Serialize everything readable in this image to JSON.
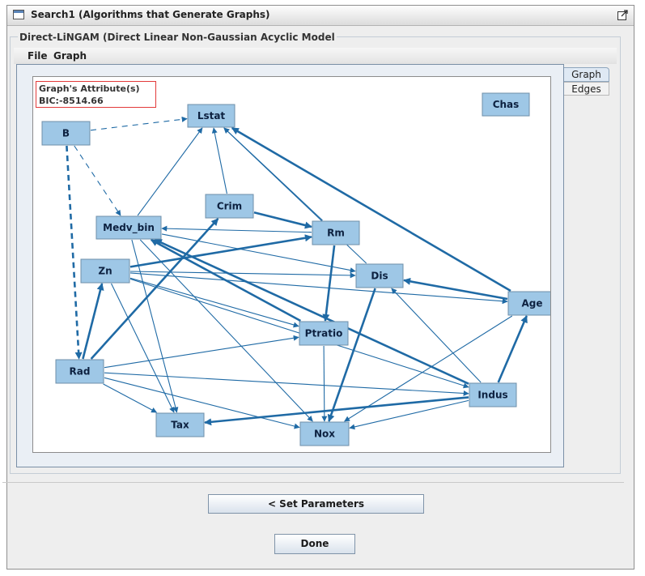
{
  "window": {
    "title": "Search1 (Algorithms that Generate Graphs)",
    "icon": "window-icon",
    "maximize_icon": "maximize-icon"
  },
  "panel": {
    "group_title": "Direct-LiNGAM (Direct Linear Non-Gaussian Acyclic Model",
    "menu": [
      "File",
      "Graph"
    ]
  },
  "graph_attributes": {
    "title": "Graph's Attribute(s)",
    "bic": "BIC:-8514.66"
  },
  "tabs": [
    {
      "label": "Graph",
      "selected": true
    },
    {
      "label": "Edges",
      "selected": false
    }
  ],
  "graph": {
    "nodes": [
      "Lstat",
      "B",
      "Chas",
      "Crim",
      "Medv_bin",
      "Rm",
      "Zn",
      "Dis",
      "Age",
      "Ptratio",
      "Rad",
      "Indus",
      "Tax",
      "Nox"
    ],
    "edges": [
      {
        "from": "B",
        "to": "Lstat",
        "style": "dashed"
      },
      {
        "from": "B",
        "to": "Medv_bin",
        "style": "dashed"
      },
      {
        "from": "B",
        "to": "Rad",
        "style": "dashed-bold"
      },
      {
        "from": "Medv_bin",
        "to": "Lstat",
        "style": "thin"
      },
      {
        "from": "Crim",
        "to": "Lstat",
        "style": "thin"
      },
      {
        "from": "Rm",
        "to": "Lstat",
        "style": "thin"
      },
      {
        "from": "Dis",
        "to": "Lstat",
        "style": "thin"
      },
      {
        "from": "Age",
        "to": "Lstat",
        "style": "bold"
      },
      {
        "from": "Crim",
        "to": "Rm",
        "style": "bold"
      },
      {
        "from": "Rm",
        "to": "Medv_bin",
        "style": "thin"
      },
      {
        "from": "Zn",
        "to": "Rm",
        "style": "bold"
      },
      {
        "from": "Rm",
        "to": "Ptratio",
        "style": "bold"
      },
      {
        "from": "Medv_bin",
        "to": "Dis",
        "style": "thin"
      },
      {
        "from": "Zn",
        "to": "Dis",
        "style": "thin"
      },
      {
        "from": "Zn",
        "to": "Age",
        "style": "thin"
      },
      {
        "from": "Zn",
        "to": "Ptratio",
        "style": "thin"
      },
      {
        "from": "Zn",
        "to": "Tax",
        "style": "thin"
      },
      {
        "from": "Rad",
        "to": "Zn",
        "style": "bold"
      },
      {
        "from": "Rad",
        "to": "Crim",
        "style": "bold"
      },
      {
        "from": "Medv_bin",
        "to": "Tax",
        "style": "thin"
      },
      {
        "from": "Medv_bin",
        "to": "Nox",
        "style": "thin"
      },
      {
        "from": "Indus",
        "to": "Medv_bin",
        "style": "bold"
      },
      {
        "from": "Ptratio",
        "to": "Medv_bin",
        "style": "bold"
      },
      {
        "from": "Age",
        "to": "Dis",
        "style": "bold"
      },
      {
        "from": "Dis",
        "to": "Nox",
        "style": "bold"
      },
      {
        "from": "Ptratio",
        "to": "Nox",
        "style": "thin"
      },
      {
        "from": "Age",
        "to": "Nox",
        "style": "thin"
      },
      {
        "from": "Indus",
        "to": "Nox",
        "style": "thin"
      },
      {
        "from": "Indus",
        "to": "Tax",
        "style": "bold"
      },
      {
        "from": "Indus",
        "to": "Age",
        "style": "bold"
      },
      {
        "from": "Indus",
        "to": "Dis",
        "style": "thin"
      },
      {
        "from": "Rad",
        "to": "Ptratio",
        "style": "thin"
      },
      {
        "from": "Rad",
        "to": "Indus",
        "style": "thin"
      },
      {
        "from": "Rad",
        "to": "Tax",
        "style": "thin"
      },
      {
        "from": "Rad",
        "to": "Nox",
        "style": "thin"
      },
      {
        "from": "Zn",
        "to": "Indus",
        "style": "thin"
      }
    ]
  },
  "colors": {
    "node_fill": "#9ec7e6",
    "node_stroke": "#6f8fa8",
    "edge": "#1f6aa5",
    "attr_border": "#e23a3a"
  },
  "buttons": {
    "set_parameters": "<  Set Parameters",
    "done": "Done"
  }
}
